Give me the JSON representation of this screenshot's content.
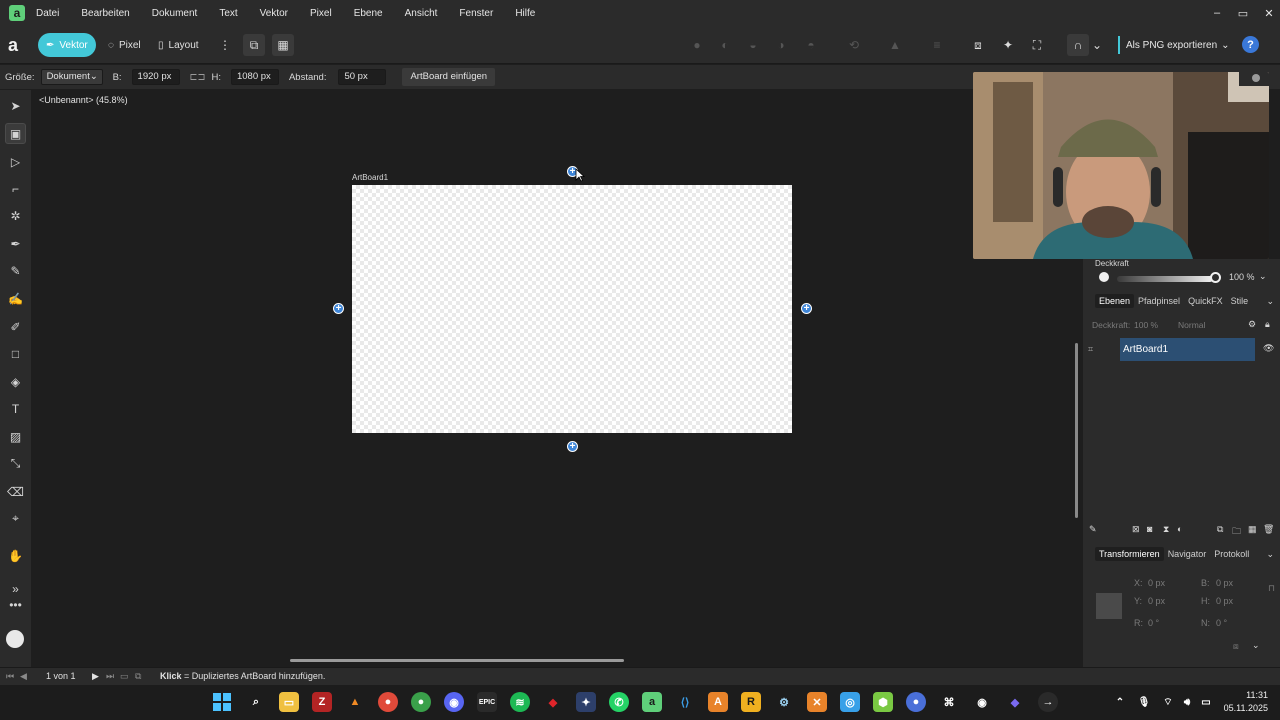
{
  "menu": [
    "Datei",
    "Bearbeiten",
    "Dokument",
    "Text",
    "Vektor",
    "Pixel",
    "Ebene",
    "Ansicht",
    "Fenster",
    "Hilfe"
  ],
  "window_controls": {
    "minimize": "–",
    "maximize": "▭",
    "close": "✕"
  },
  "toolbar": {
    "personas": [
      {
        "label": "Vektor",
        "active": true
      },
      {
        "label": "Pixel",
        "active": false
      },
      {
        "label": "Layout",
        "active": false
      }
    ],
    "export_label": "Als PNG exportieren",
    "help": "?"
  },
  "context": {
    "size_label": "Größe:",
    "size_value": "Dokument",
    "width_label": "B:",
    "width_value": "1920 px",
    "height_label": "H:",
    "height_value": "1080 px",
    "spacing_label": "Abstand:",
    "spacing_value": "50 px",
    "insert_button": "ArtBoard einfügen"
  },
  "canvas": {
    "doc_title": "<Unbenannt> (45.8%)",
    "artboard_label": "ArtBoard1"
  },
  "panel": {
    "opacity_label": "Deckkraft",
    "opacity_value": "100 %",
    "tabs1": [
      "Ebenen",
      "Pfadpinsel",
      "QuickFX",
      "Stile"
    ],
    "layer_opacity_label": "Deckkraft:",
    "layer_opacity_value": "100 %",
    "blend_mode": "Normal",
    "layer_name": "ArtBoard1",
    "tabs2": [
      "Transformieren",
      "Navigator",
      "Protokoll"
    ],
    "transform": {
      "x_label": "X:",
      "x_value": "0 px",
      "y_label": "Y:",
      "y_value": "0 px",
      "b_label": "B:",
      "b_value": "0 px",
      "h_label": "H:",
      "h_value": "0 px",
      "r_label": "R:",
      "r_value": "0 °",
      "n_label": "N:",
      "n_value": "0 °"
    }
  },
  "status": {
    "page": "1 von 1",
    "hint_bold": "Klick",
    "hint": "= Dupliziertes ArtBoard hinzufügen."
  },
  "taskbar": {
    "time": "11:31",
    "date": "05.11.2025"
  },
  "colors": {
    "accent": "#43c8d8",
    "selection": "#2c4f73",
    "handle": "#3f86d8"
  }
}
